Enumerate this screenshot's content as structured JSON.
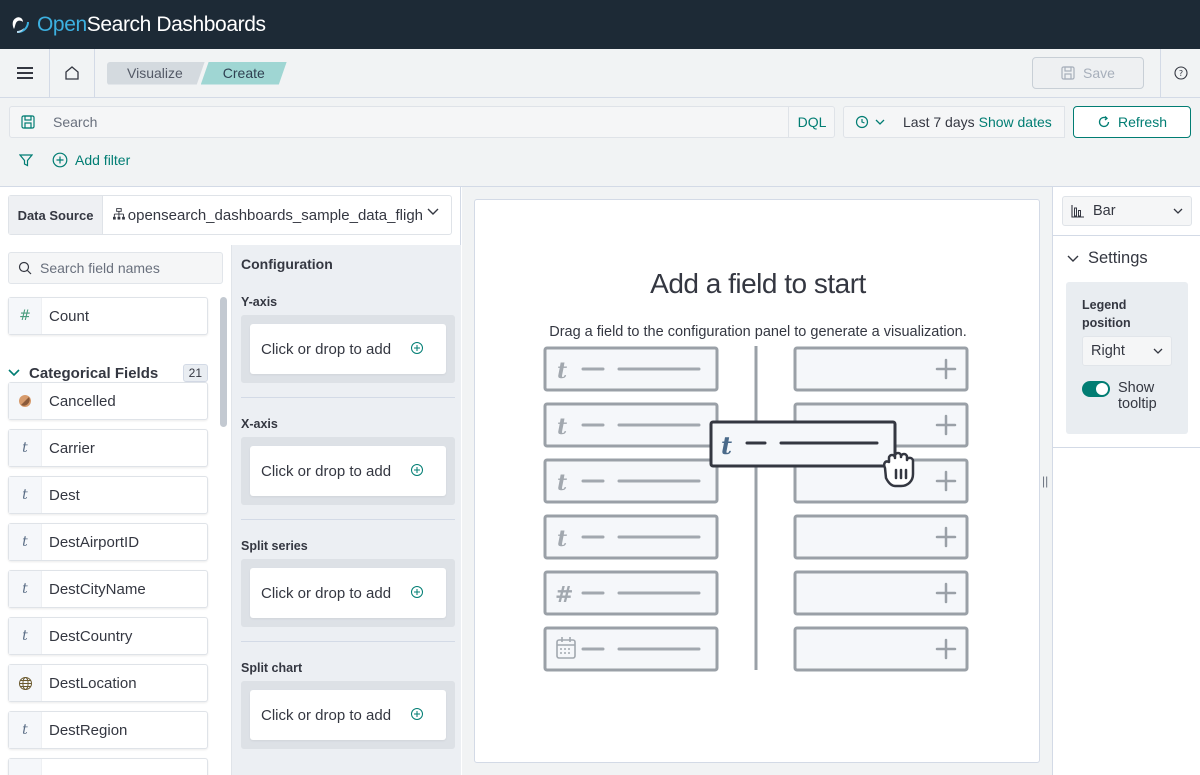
{
  "header": {
    "logo_open": "Open",
    "logo_rest": "Search Dashboards"
  },
  "nav": {
    "breadcrumbs": [
      "Visualize",
      "Create"
    ],
    "save_label": "Save"
  },
  "query": {
    "search_placeholder": "Search",
    "language": "DQL",
    "date_range": "Last 7 days",
    "show_dates": "Show dates",
    "refresh_label": "Refresh",
    "add_filter": "Add filter"
  },
  "data_source": {
    "label": "Data Source",
    "value": "opensearch_dashboards_sample_data_fligh"
  },
  "fields": {
    "search_placeholder": "Search field names",
    "count_field": {
      "icon": "#",
      "label": "Count"
    },
    "categorical_title": "Categorical Fields",
    "categorical_count": "21",
    "items": [
      {
        "icon": "boolean-icon",
        "label": "Cancelled"
      },
      {
        "icon": "t",
        "label": "Carrier"
      },
      {
        "icon": "t",
        "label": "Dest"
      },
      {
        "icon": "t",
        "label": "DestAirportID"
      },
      {
        "icon": "t",
        "label": "DestCityName"
      },
      {
        "icon": "t",
        "label": "DestCountry"
      },
      {
        "icon": "globe-icon",
        "label": "DestLocation"
      },
      {
        "icon": "t",
        "label": "DestRegion"
      }
    ]
  },
  "configuration": {
    "title": "Configuration",
    "sections": [
      {
        "label": "Y-axis",
        "drop_text": "Click or drop to add"
      },
      {
        "label": "X-axis",
        "drop_text": "Click or drop to add"
      },
      {
        "label": "Split series",
        "drop_text": "Click or drop to add"
      },
      {
        "label": "Split chart",
        "drop_text": "Click or drop to add"
      }
    ]
  },
  "canvas": {
    "title": "Add a field to start",
    "subtitle": "Drag a field to the configuration panel to generate a visualization."
  },
  "right_panel": {
    "vis_type": "Bar",
    "settings_title": "Settings",
    "legend_label": "Legend position",
    "legend_value": "Right",
    "tooltip_label": "Show tooltip"
  },
  "colors": {
    "accent": "#017d73",
    "header_bg": "#1d2a36",
    "logo_blue": "#3cb0e0"
  }
}
